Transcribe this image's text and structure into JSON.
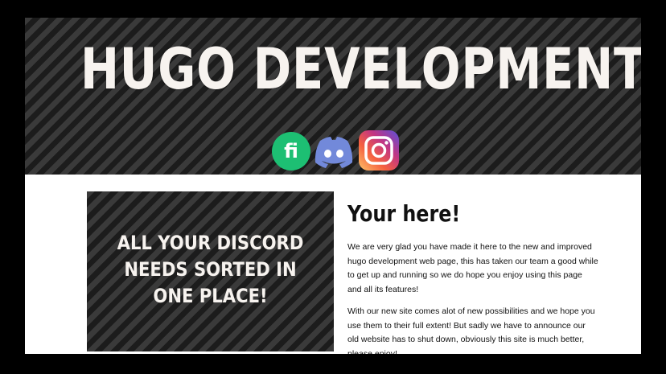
{
  "header": {
    "title": "HUGO DEVELOPMENT",
    "socials": [
      {
        "name": "fiverr-icon",
        "label": "fi",
        "color": "#1dbf73"
      },
      {
        "name": "discord-icon",
        "color": "#7289da"
      },
      {
        "name": "instagram-icon",
        "color": "#c13584"
      }
    ]
  },
  "main": {
    "banner_text": "ALL YOUR DISCORD NEEDS SORTED IN ONE PLACE!",
    "heading": "Your here!",
    "paragraphs": [
      "We are very glad you have made it here to the new and improved hugo development web page, this has taken our team a good while to get up and running so we do hope you enjoy using this page and all its features!",
      "With our new site comes alot of new possibilities and we hope you use them to their full extent! But sadly we have to announce our old website has to shut down, obviously this site is much better, please enjoy!"
    ]
  }
}
